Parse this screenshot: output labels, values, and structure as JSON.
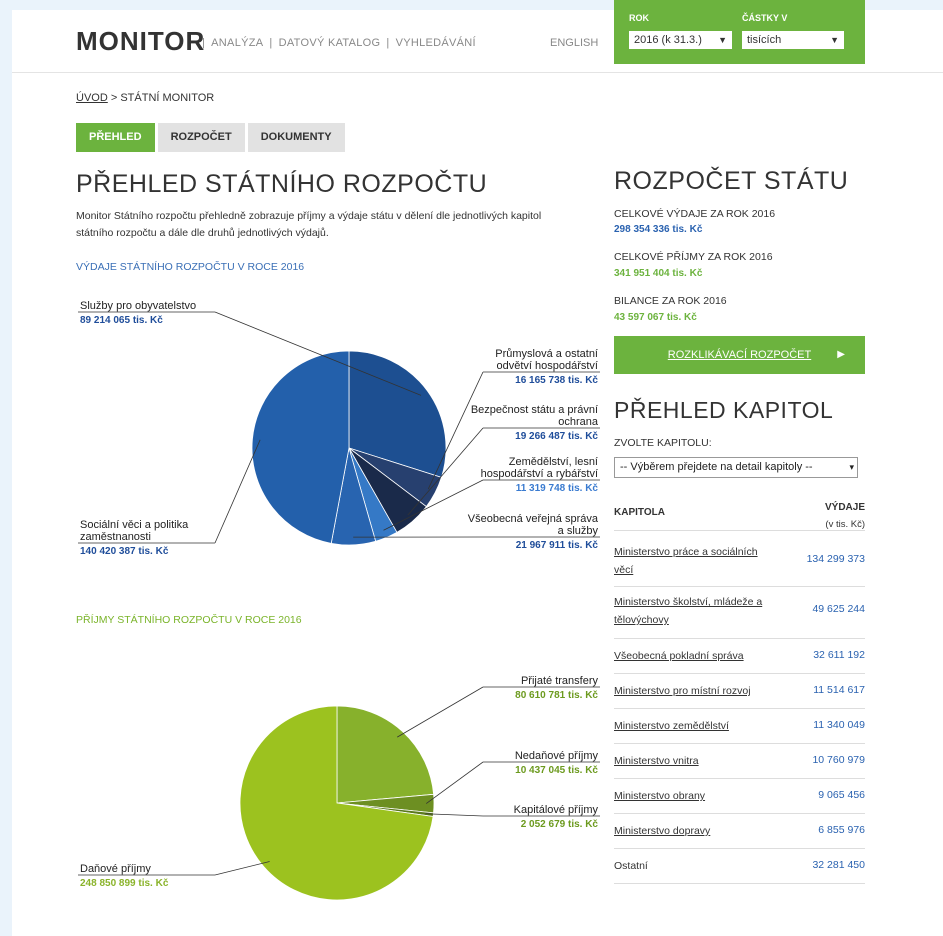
{
  "header": {
    "logo": "MONITOR",
    "nav": [
      "ANALÝZA",
      "DATOVÝ KATALOG",
      "VYHLEDÁVÁNÍ"
    ],
    "nav_sep": "|",
    "lang": "ENGLISH",
    "rok_label": "ROK",
    "rok_value": "2016 (k 31.3.)",
    "castky_label": "ČÁSTKY V",
    "castky_value": "tisících"
  },
  "breadcrumb": {
    "home": "ÚVOD",
    "sep": " > ",
    "current": "STÁTNÍ MONITOR"
  },
  "tabs": [
    "PŘEHLED",
    "ROZPOČET",
    "DOKUMENTY"
  ],
  "main": {
    "title": "PŘEHLED STÁTNÍHO ROZPOČTU",
    "intro": "Monitor Státního rozpočtu přehledně zobrazuje příjmy a výdaje státu v dělení dle jednotlivých kapitol státního rozpočtu a dále dle druhů jednotlivých výdajů.",
    "expenses_heading": "VÝDAJE STÁTNÍHO ROZPOČTU V ROCE 2016",
    "revenues_heading": "PŘÍJMY STÁTNÍHO ROZPOČTU V ROCE 2016"
  },
  "chart_data": [
    {
      "type": "pie",
      "title": "VÝDAJE STÁTNÍHO ROZPOČTU V ROCE 2016",
      "slices": [
        {
          "label": "Služby pro obyvatelstvo",
          "value": 89214065,
          "display": "89 214 065 tis. Kč",
          "color": "#1d4f91"
        },
        {
          "label": "Průmyslová a ostatní odvětví hospodářství",
          "value": 16165738,
          "display": "16 165 738 tis. Kč",
          "color": "#27406f"
        },
        {
          "label": "Bezpečnost státu a právní ochrana",
          "value": 19266487,
          "display": "19 266 487 tis. Kč",
          "color": "#1a2a4a"
        },
        {
          "label": "Zemědělství, lesní hospodářství a rybářství",
          "value": 11319748,
          "display": "11 319 748 tis. Kč",
          "color": "#3579c6"
        },
        {
          "label": "Všeobecná veřejná správa a služby",
          "value": 21967911,
          "display": "21 967 911 tis. Kč",
          "color": "#2864b0"
        },
        {
          "label": "Sociální věci a politika zaměstnanosti",
          "value": 140420387,
          "display": "140 420 387 tis. Kč",
          "color": "#2360ab"
        }
      ]
    },
    {
      "type": "pie",
      "title": "PŘÍJMY STÁTNÍHO ROZPOČTU V ROCE 2016",
      "slices": [
        {
          "label": "Přijaté transfery",
          "value": 80610781,
          "display": "80 610 781 tis. Kč",
          "color": "#87b12c"
        },
        {
          "label": "Nedaňové příjmy",
          "value": 10437045,
          "display": "10 437 045 tis. Kč",
          "color": "#6d8f22"
        },
        {
          "label": "Kapitálové příjmy",
          "value": 2052679,
          "display": "2 052 679 tis. Kč",
          "color": "#5c7a1d"
        },
        {
          "label": "Daňové příjmy",
          "value": 248850899,
          "display": "248 850 899 tis. Kč",
          "color": "#9cc21f"
        }
      ]
    }
  ],
  "sidebar": {
    "title": "ROZPOČET STÁTU",
    "stats": [
      {
        "label": "CELKOVÉ VÝDAJE ZA ROK 2016",
        "value": "298 354 336 tis. Kč",
        "color": "#2a62b0"
      },
      {
        "label": "CELKOVÉ PŘÍJMY ZA ROK 2016",
        "value": "341 951 404 tis. Kč",
        "color": "#6cb33e"
      },
      {
        "label": "BILANCE ZA ROK 2016",
        "value": "43 597 067 tis. Kč",
        "color": "#6cb33e"
      }
    ],
    "button": "ROZKLIKÁVACÍ ROZPOČET",
    "chapters_title": "PŘEHLED KAPITOL",
    "choose_label": "ZVOLTE KAPITOLU:",
    "select_value": "-- Výběrem přejdete na detail kapitoly --",
    "table": {
      "col1": "KAPITOLA",
      "col2": "VÝDAJE",
      "col2_sub": "(v tis. Kč)",
      "rows": [
        {
          "name": "Ministerstvo práce a sociálních věcí",
          "value": "134 299 373"
        },
        {
          "name": "Ministerstvo školství, mládeže a tělovýchovy",
          "value": "49 625 244"
        },
        {
          "name": "Všeobecná pokladní správa",
          "value": "32 611 192"
        },
        {
          "name": "Ministerstvo pro místní rozvoj",
          "value": "11 514 617"
        },
        {
          "name": "Ministerstvo zemědělství",
          "value": "11 340 049"
        },
        {
          "name": "Ministerstvo vnitra",
          "value": "10 760 979"
        },
        {
          "name": "Ministerstvo obrany",
          "value": "9 065 456"
        },
        {
          "name": "Ministerstvo dopravy",
          "value": "6 855 976"
        },
        {
          "name": "Ostatní",
          "value": "32 281 450"
        }
      ]
    }
  }
}
